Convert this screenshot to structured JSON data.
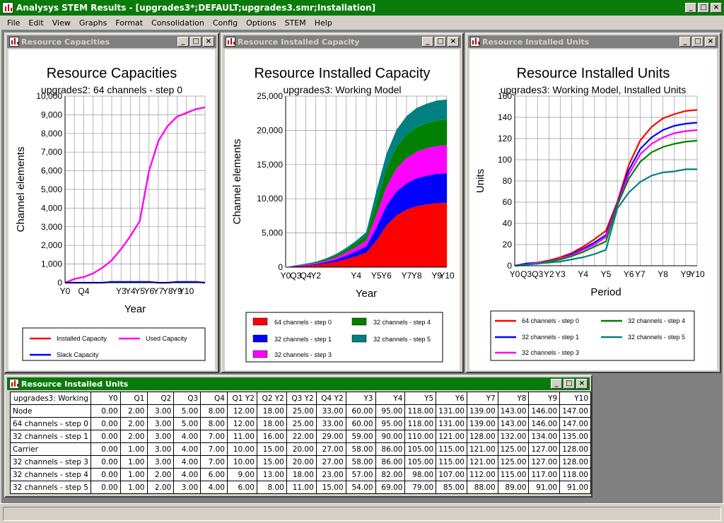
{
  "app": {
    "title": "Analysys STEM Results - [upgrades3*;DEFAULT;upgrades3.smr;Installation]",
    "window_buttons": [
      "_",
      "□",
      "×"
    ]
  },
  "menu": [
    "File",
    "Edit",
    "View",
    "Graphs",
    "Format",
    "Consolidation",
    "Config",
    "Options",
    "STEM",
    "Help"
  ],
  "colors": {
    "titlebar_active": "#0a7a0a",
    "titlebar_inactive": "#808080"
  },
  "windows": {
    "cap": {
      "title": "Resource Capacities"
    },
    "inst": {
      "title": "Resource Installed Capacity"
    },
    "units": {
      "title": "Resource Installed Units"
    },
    "table": {
      "title": "Resource Installed Units"
    }
  },
  "chart_data": [
    {
      "type": "line",
      "title": "Resource Capacities",
      "subtitle": "upgrades2: 64 channels - step 0",
      "xlabel": "Year",
      "ylabel": "Channel elements",
      "x_ticks": [
        "Y0",
        "Q4",
        "Y3",
        "Y4",
        "Y5",
        "Y6",
        "Y7",
        "Y8",
        "Y9",
        "Y10"
      ],
      "ylim": [
        0,
        10000
      ],
      "y_ticks": [
        "0",
        "1,000",
        "2,000",
        "3,000",
        "4,000",
        "5,000",
        "6,000",
        "7,000",
        "8,000",
        "9,000",
        "10,000"
      ],
      "grid": true,
      "legend_position": "bottom",
      "series": [
        {
          "name": "Installed Capacity",
          "color": "#ff0000",
          "values": [
            0,
            200,
            300,
            500,
            800,
            1200,
            1800,
            2500,
            3300,
            6000,
            7600,
            8400,
            8900,
            9100,
            9300,
            9400
          ]
        },
        {
          "name": "Used Capacity",
          "color": "#ff00ff",
          "values": [
            0,
            200,
            300,
            500,
            800,
            1200,
            1800,
            2500,
            3300,
            6000,
            7600,
            8400,
            8900,
            9100,
            9300,
            9400
          ]
        },
        {
          "name": "Slack Capacity",
          "color": "#0000ff",
          "values": [
            0,
            0,
            0,
            0,
            0,
            40,
            40,
            40,
            40,
            40,
            0,
            0,
            40,
            40,
            40,
            0
          ]
        }
      ]
    },
    {
      "type": "area",
      "title": "Resource Installed Capacity",
      "subtitle": "upgrades3: Working Model",
      "xlabel": "Year",
      "ylabel": "Channel elements",
      "x_ticks": [
        "Y0",
        "Q3",
        "Q4",
        "Y2",
        "Y4",
        "Y5",
        "Y6",
        "Y7",
        "Y8",
        "Y9",
        "Y10"
      ],
      "ylim": [
        0,
        25000
      ],
      "y_ticks": [
        "0",
        "5,000",
        "10,000",
        "15,000",
        "20,000",
        "25,000"
      ],
      "grid": true,
      "stacked": true,
      "legend_position": "bottom",
      "series": [
        {
          "name": "64 channels - step 0",
          "color": "#ff0000",
          "values": [
            0,
            128,
            192,
            320,
            512,
            768,
            1152,
            1600,
            2112,
            3840,
            6080,
            7552,
            8384,
            8896,
            9152,
            9344,
            9408
          ]
        },
        {
          "name": "32 channels - step 1",
          "color": "#0000ff",
          "values": [
            0,
            64,
            96,
            128,
            224,
            352,
            512,
            704,
            928,
            1888,
            2880,
            3520,
            3872,
            4096,
            4224,
            4288,
            4320
          ]
        },
        {
          "name": "32 channels - step 3",
          "color": "#ff00ff",
          "values": [
            0,
            32,
            96,
            128,
            224,
            320,
            480,
            640,
            864,
            1856,
            2752,
            3360,
            3680,
            3872,
            4000,
            4064,
            4096
          ]
        },
        {
          "name": "32 channels - step 4",
          "color": "#008000",
          "values": [
            0,
            32,
            64,
            128,
            192,
            288,
            416,
            576,
            736,
            1824,
            2624,
            3136,
            3424,
            3584,
            3680,
            3744,
            3776
          ]
        },
        {
          "name": "32 channels - step 5",
          "color": "#008080",
          "values": [
            0,
            32,
            64,
            96,
            128,
            192,
            256,
            352,
            480,
            1728,
            2208,
            2528,
            2720,
            2816,
            2848,
            2912,
            2912
          ]
        }
      ]
    },
    {
      "type": "line",
      "title": "Resource Installed Units",
      "subtitle": "upgrades3: Working Model, Installed Units",
      "xlabel": "Period",
      "ylabel": "Units",
      "x_ticks": [
        "Y0",
        "Q3",
        "Q3",
        "Y2",
        "Y3",
        "Y4",
        "Y5",
        "Y6",
        "Y7",
        "Y8",
        "Y9",
        "Y10"
      ],
      "ylim": [
        0,
        160
      ],
      "y_ticks": [
        "0",
        "20",
        "40",
        "60",
        "80",
        "100",
        "120",
        "140",
        "160"
      ],
      "grid": true,
      "legend_position": "bottom",
      "series": [
        {
          "name": "64 channels - step 0",
          "color": "#ff0000",
          "values": [
            0,
            2,
            3,
            5,
            8,
            12,
            18,
            25,
            33,
            60,
            95,
            118,
            131,
            139,
            143,
            146,
            147
          ]
        },
        {
          "name": "32 channels - step 1",
          "color": "#0000ff",
          "values": [
            0,
            2,
            3,
            4,
            7,
            11,
            16,
            22,
            29,
            59,
            90,
            110,
            121,
            128,
            132,
            134,
            135
          ]
        },
        {
          "name": "32 channels - step 3",
          "color": "#ff00ff",
          "values": [
            0,
            1,
            3,
            4,
            7,
            10,
            15,
            20,
            27,
            58,
            86,
            105,
            115,
            121,
            125,
            127,
            128
          ]
        },
        {
          "name": "32 channels - step 4",
          "color": "#008000",
          "values": [
            0,
            1,
            2,
            4,
            6,
            9,
            13,
            18,
            23,
            57,
            82,
            98,
            107,
            112,
            115,
            117,
            118
          ]
        },
        {
          "name": "32 channels - step 5",
          "color": "#008080",
          "values": [
            0,
            1,
            2,
            3,
            4,
            6,
            8,
            11,
            15,
            54,
            69,
            79,
            85,
            88,
            89,
            91,
            91
          ]
        }
      ]
    },
    {
      "type": "table",
      "corner": "upgrades3: Working",
      "columns": [
        "Y0",
        "Q1",
        "Q2",
        "Q3",
        "Q4",
        "Q1 Y2",
        "Q2 Y2",
        "Q3 Y2",
        "Q4 Y2",
        "Y3",
        "Y4",
        "Y5",
        "Y6",
        "Y7",
        "Y8",
        "Y9",
        "Y10"
      ],
      "rows": [
        {
          "label": "Node",
          "values": [
            "0.00",
            "2.00",
            "3.00",
            "5.00",
            "8.00",
            "12.00",
            "18.00",
            "25.00",
            "33.00",
            "60.00",
            "95.00",
            "118.00",
            "131.00",
            "139.00",
            "143.00",
            "146.00",
            "147.00"
          ]
        },
        {
          "label": "64 channels - step 0",
          "values": [
            "0.00",
            "2.00",
            "3.00",
            "5.00",
            "8.00",
            "12.00",
            "18.00",
            "25.00",
            "33.00",
            "60.00",
            "95.00",
            "118.00",
            "131.00",
            "139.00",
            "143.00",
            "146.00",
            "147.00"
          ]
        },
        {
          "label": "32 channels - step 1",
          "values": [
            "0.00",
            "2.00",
            "3.00",
            "4.00",
            "7.00",
            "11.00",
            "16.00",
            "22.00",
            "29.00",
            "59.00",
            "90.00",
            "110.00",
            "121.00",
            "128.00",
            "132.00",
            "134.00",
            "135.00"
          ]
        },
        {
          "label": "Carrier",
          "values": [
            "0.00",
            "1.00",
            "3.00",
            "4.00",
            "7.00",
            "10.00",
            "15.00",
            "20.00",
            "27.00",
            "58.00",
            "86.00",
            "105.00",
            "115.00",
            "121.00",
            "125.00",
            "127.00",
            "128.00"
          ]
        },
        {
          "label": "32 channels - step 3",
          "values": [
            "0.00",
            "1.00",
            "3.00",
            "4.00",
            "7.00",
            "10.00",
            "15.00",
            "20.00",
            "27.00",
            "58.00",
            "86.00",
            "105.00",
            "115.00",
            "121.00",
            "125.00",
            "127.00",
            "128.00"
          ]
        },
        {
          "label": "32 channels - step 4",
          "values": [
            "0.00",
            "1.00",
            "2.00",
            "4.00",
            "6.00",
            "9.00",
            "13.00",
            "18.00",
            "23.00",
            "57.00",
            "82.00",
            "98.00",
            "107.00",
            "112.00",
            "115.00",
            "117.00",
            "118.00"
          ]
        },
        {
          "label": "32 channels - step 5",
          "values": [
            "0.00",
            "1.00",
            "2.00",
            "3.00",
            "4.00",
            "6.00",
            "8.00",
            "11.00",
            "15.00",
            "54.00",
            "69.00",
            "79.00",
            "85.00",
            "88.00",
            "89.00",
            "91.00",
            "91.00"
          ]
        }
      ]
    }
  ]
}
